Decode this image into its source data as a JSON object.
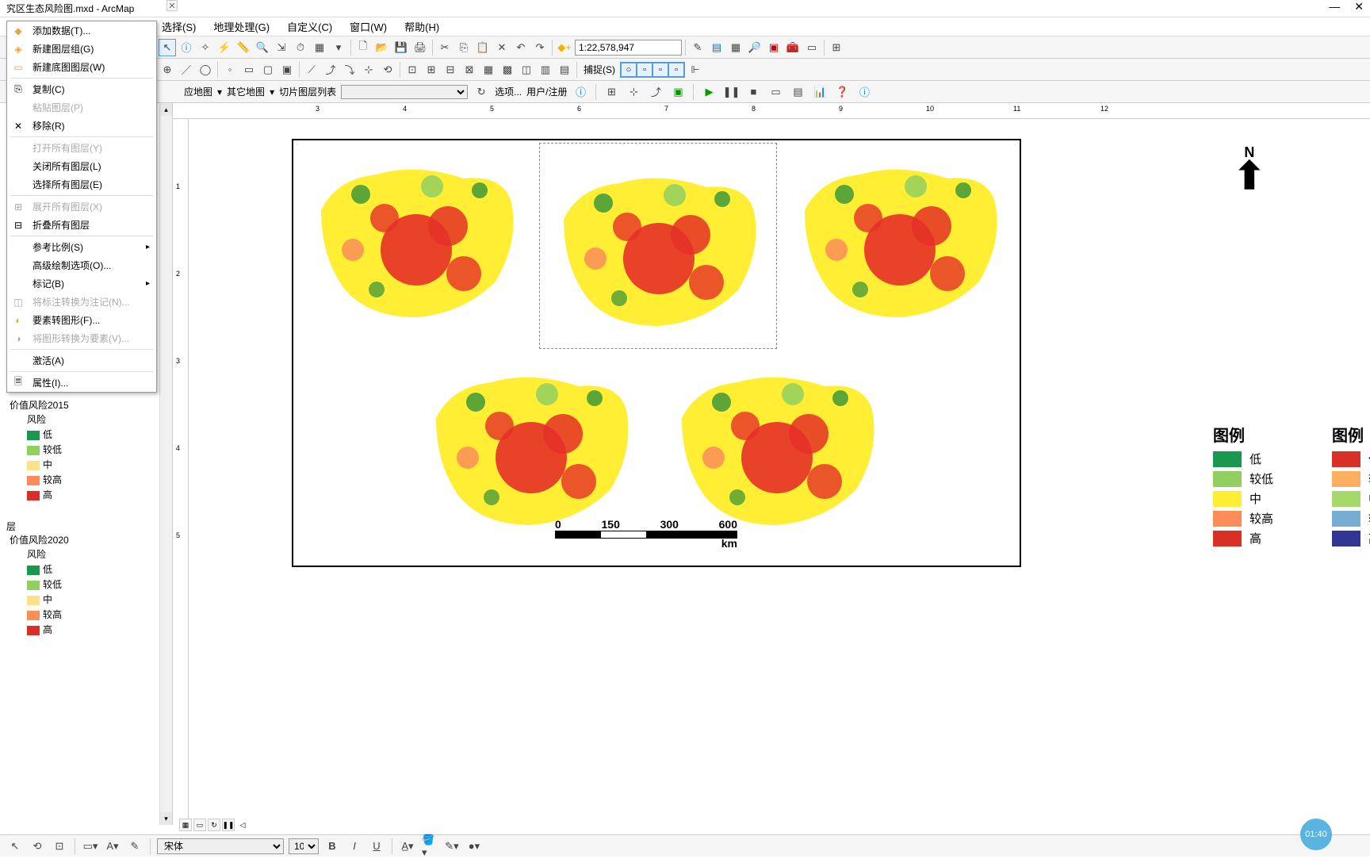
{
  "window": {
    "title": "究区生态风险图.mxd - ArcMap"
  },
  "win_controls": {
    "min": "—",
    "close": "✕"
  },
  "menubar": {
    "select": "选择(S)",
    "geoproc": "地理处理(G)",
    "custom": "自定义(C)",
    "window": "窗口(W)",
    "help": "帮助(H)"
  },
  "context_menu": {
    "add_data": "添加数据(T)...",
    "new_group": "新建图层组(G)",
    "new_basemap": "新建底图图层(W)",
    "copy": "复制(C)",
    "paste": "粘贴图层(P)",
    "remove": "移除(R)",
    "open_all": "打开所有图层(Y)",
    "close_all": "关闭所有图层(L)",
    "select_all": "选择所有图层(E)",
    "expand_all": "展开所有图层(X)",
    "collapse_all": "折叠所有图层",
    "ref_scale": "参考比例(S)",
    "adv_draw": "高级绘制选项(O)...",
    "label": "标记(B)",
    "convert_anno": "将标注转换为注记(N)...",
    "feat_to_graphic": "要素转图形(F)...",
    "graphic_to_feat": "将图形转换为要素(V)...",
    "activate": "激活(A)",
    "properties": "属性(I)..."
  },
  "toolbar": {
    "scale": "1:22,578,947"
  },
  "toolbar2": {
    "snap": "捕捉(S)"
  },
  "toolbar3": {
    "bing_map": "应地图",
    "other_map": "其它地图",
    "tile_list": "切片图层列表",
    "option": "选项...",
    "user": "用户/注册"
  },
  "ruler_h": [
    "3",
    "4",
    "5",
    "6",
    "7",
    "8",
    "9",
    "10",
    "11",
    "12"
  ],
  "ruler_v": [
    "1",
    "2",
    "3",
    "4",
    "5"
  ],
  "toc": {
    "layer2015": "价值风险2015",
    "risk": "风险",
    "low": "低",
    "lower": "较低",
    "mid": "中",
    "higher": "较高",
    "high": "高",
    "group_layer": "层",
    "layer2020": "价值风险2020"
  },
  "layout": {
    "compass_n": "N",
    "scalebar": {
      "v0": "0",
      "v1": "150",
      "v2": "300",
      "v3": "600",
      "km": "km"
    },
    "legend_title": "图例",
    "l_low": "低",
    "l_lower": "较低",
    "l_mid": "中",
    "l_higher": "较高",
    "l_high": "高",
    "l2_low": "低",
    "l2_lower": "较低",
    "l2_mid": "中",
    "l2_higher": "较高",
    "l2_high": "高"
  },
  "bottom": {
    "font": "宋体",
    "size": "10",
    "bold": "B",
    "italic": "I",
    "underline": "U"
  },
  "timer": "01:40",
  "tabclose": "✕"
}
